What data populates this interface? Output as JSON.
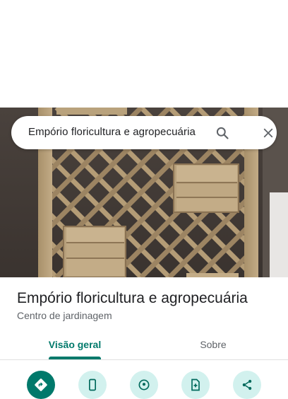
{
  "search": {
    "query": "Empório floricultura e agropecuária",
    "search_icon": "search-icon",
    "close_icon": "close-icon"
  },
  "photo": {
    "subject": "wooden-lattice-planter-photo"
  },
  "place": {
    "name": "Empório floricultura e agropecuária",
    "category": "Centro de jardinagem"
  },
  "tabs": [
    {
      "label": "Visão geral",
      "active": true
    },
    {
      "label": "Sobre",
      "active": false
    }
  ],
  "actions": [
    {
      "icon": "directions-icon"
    },
    {
      "icon": "phone-icon"
    },
    {
      "icon": "location-share-icon"
    },
    {
      "icon": "save-icon"
    },
    {
      "icon": "share-icon"
    }
  ],
  "colors": {
    "accent": "#00796b",
    "accent_light": "#d2f1ee",
    "text_primary": "#202124",
    "text_secondary": "#5f6368"
  }
}
